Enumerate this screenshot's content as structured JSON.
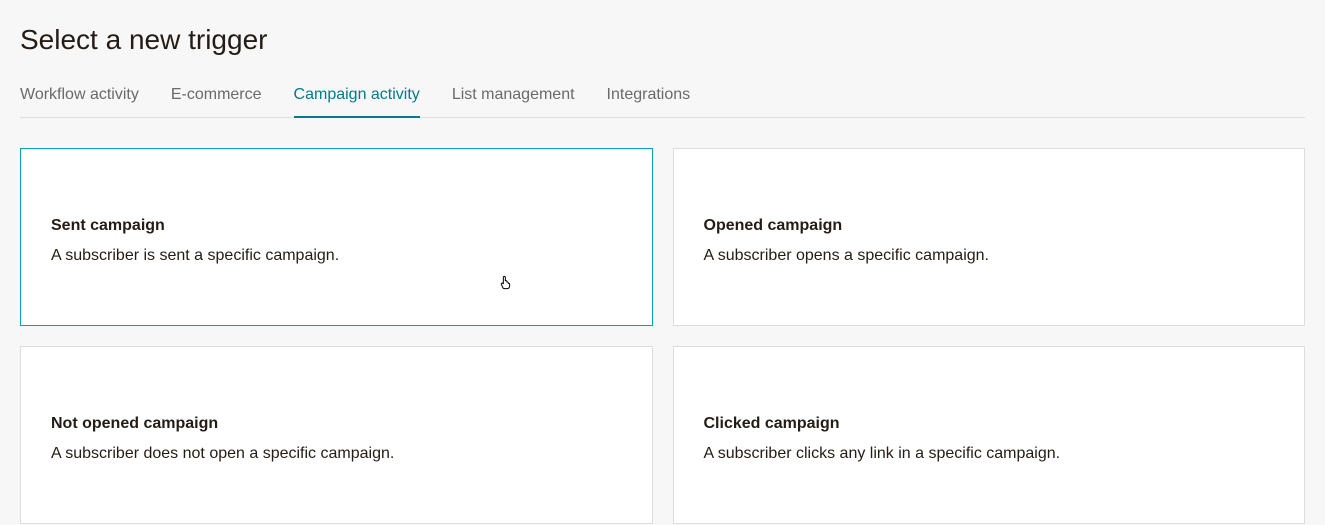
{
  "page": {
    "title": "Select a new trigger"
  },
  "tabs": [
    {
      "label": "Workflow activity",
      "active": false
    },
    {
      "label": "E-commerce",
      "active": false
    },
    {
      "label": "Campaign activity",
      "active": true
    },
    {
      "label": "List management",
      "active": false
    },
    {
      "label": "Integrations",
      "active": false
    }
  ],
  "cards": [
    {
      "title": "Sent campaign",
      "description": "A subscriber is sent a specific campaign.",
      "selected": true
    },
    {
      "title": "Opened campaign",
      "description": "A subscriber opens a specific campaign.",
      "selected": false
    },
    {
      "title": "Not opened campaign",
      "description": "A subscriber does not open a specific campaign.",
      "selected": false
    },
    {
      "title": "Clicked campaign",
      "description": "A subscriber clicks any link in a specific campaign.",
      "selected": false
    }
  ]
}
